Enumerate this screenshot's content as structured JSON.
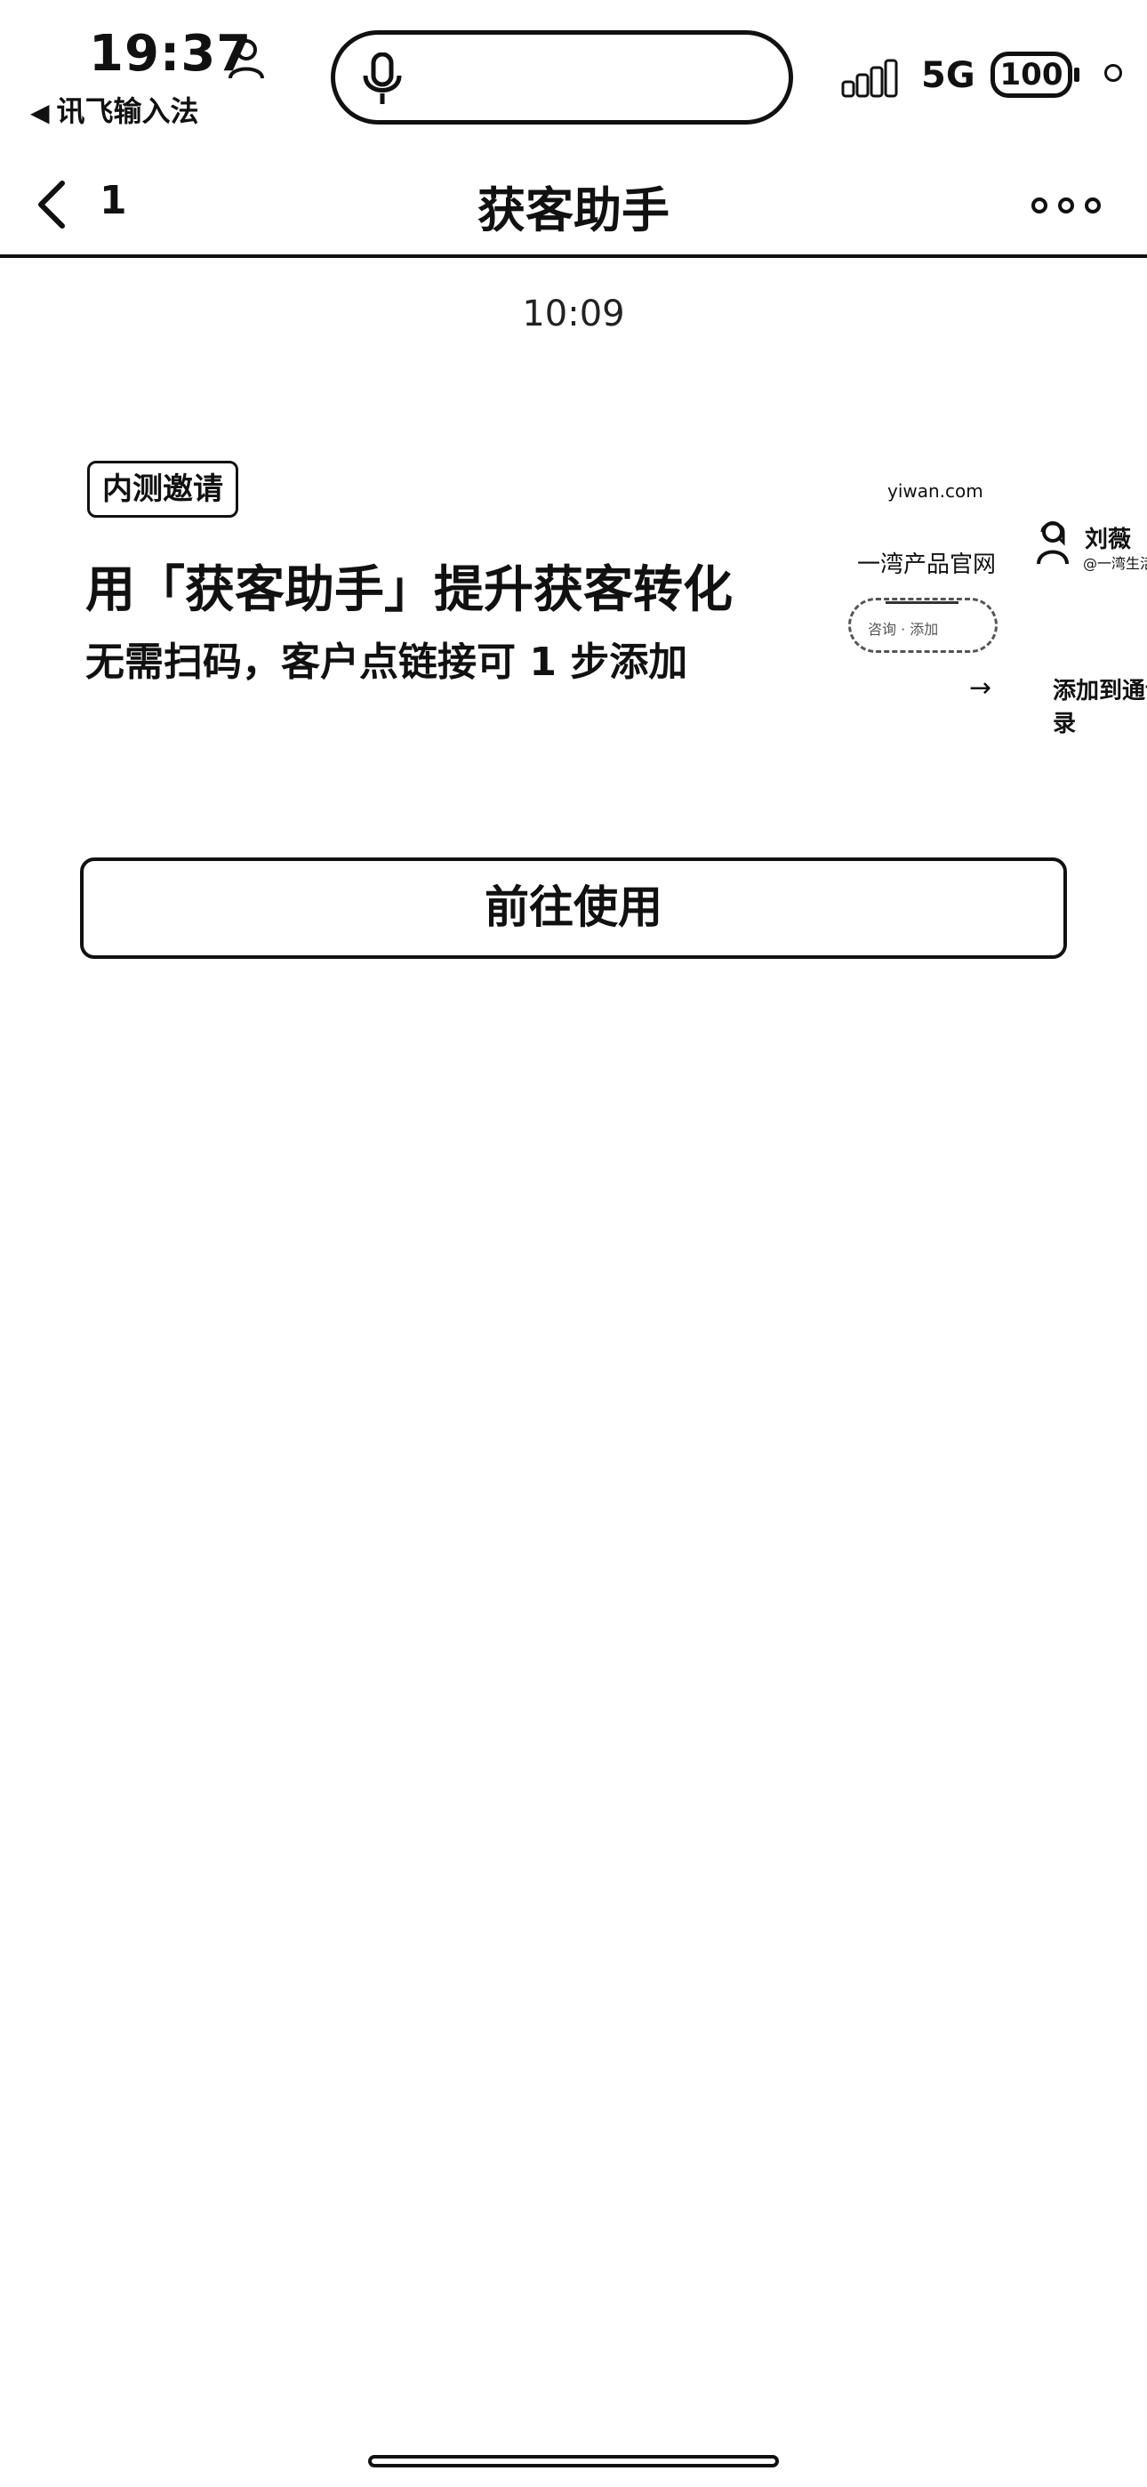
{
  "status_bar": {
    "time": "19:37",
    "back_app": "讯飞输入法",
    "network": "5G",
    "battery": "100"
  },
  "nav": {
    "back_count": "1",
    "title": "获客助手"
  },
  "message": {
    "time": "10:09",
    "tag": "内测邀请",
    "headline": "用「获客助手」提升获客转化",
    "subline": "无需扫码，客户点链接可 1 步添加",
    "preview": {
      "site": "yiwan.com",
      "official_site": "一湾产品官网",
      "oval_text": "咨询 · 添加",
      "contact_name": "刘薇",
      "contact_handle": "@一湾生活",
      "add_label": "添加到通讯录"
    },
    "button_label": "前往使用"
  },
  "icons": {
    "person": "person-icon",
    "mic": "mic-icon",
    "signal": "signal-icon",
    "back": "chevron-left-icon",
    "more": "more-icon",
    "arrow": "arrow-right-icon"
  }
}
